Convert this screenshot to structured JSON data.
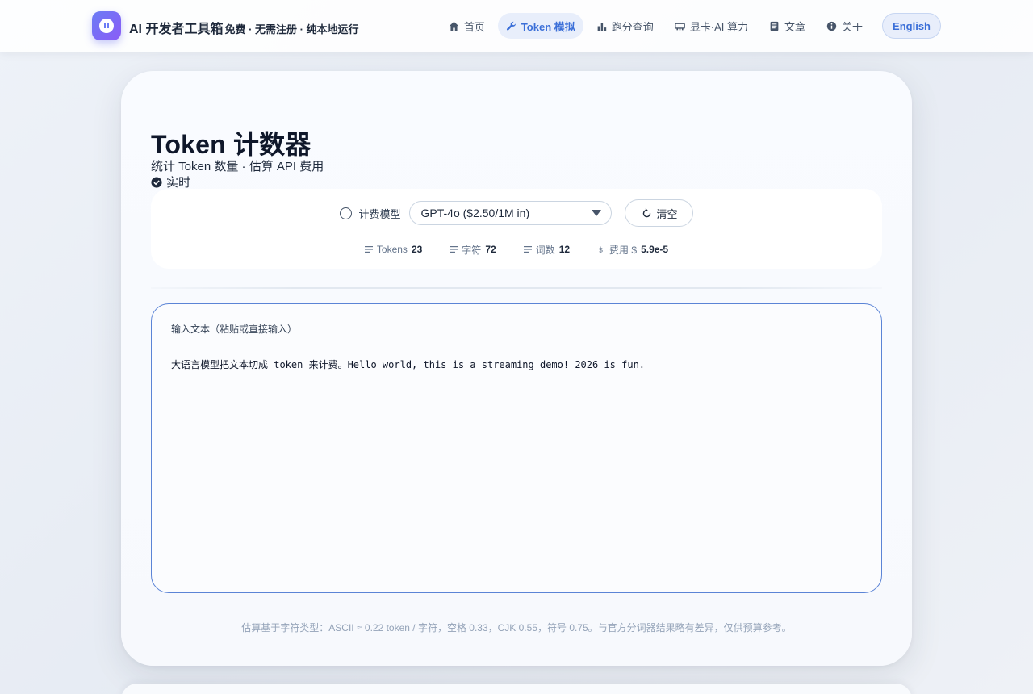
{
  "header": {
    "brand_title": "AI 开发者工具箱",
    "brand_sub": "免费 · 无需注册 · 纯本地运行",
    "nav": [
      {
        "label": "首页",
        "icon": "home-icon"
      },
      {
        "label": "Token 模拟",
        "icon": "wrench-icon",
        "active": true
      },
      {
        "label": "跑分查询",
        "icon": "bar-chart-icon"
      },
      {
        "label": "显卡·AI 算力",
        "icon": "gpu-icon"
      },
      {
        "label": "文章",
        "icon": "article-icon"
      },
      {
        "label": "关于",
        "icon": "info-icon"
      }
    ],
    "lang_button": "English"
  },
  "main": {
    "title": "Token 计数器",
    "subtitle": "统计 Token 数量 · 估算 API 费用",
    "realtime": "实时",
    "model_label": "计费模型",
    "model_selected": "GPT-4o ($2.50/1M in)",
    "clear_button": "清空",
    "stats": {
      "tokens_label": "Tokens",
      "tokens_value": "23",
      "chars_label": "字符",
      "chars_value": "72",
      "words_label": "词数",
      "words_value": "12",
      "cost_label": "费用 $",
      "cost_value": "5.9e-5"
    },
    "input_label": "输入文本（粘贴或直接输入）",
    "input_value": "大语言模型把文本切成 token 来计费。Hello world, this is a streaming demo! 2026 is fun.",
    "footnote": "估算基于字符类型：ASCII ≈ 0.22 token / 字符，空格 0.33，CJK 0.55，符号 0.75。与官方分词器结果略有差异，仅供预算参考。"
  },
  "colors": {
    "accent": "#3b6fd8",
    "logo_gradient_start": "#6b7cf5",
    "logo_gradient_end": "#8b5cf6"
  }
}
